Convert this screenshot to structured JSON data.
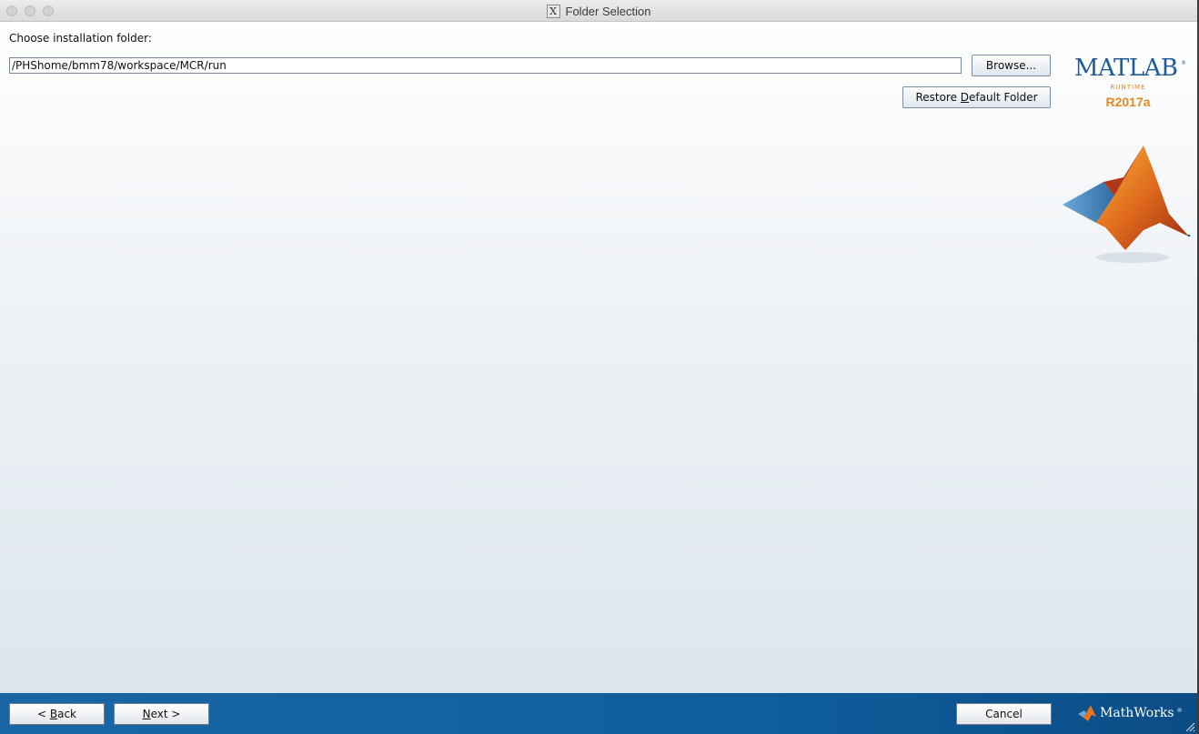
{
  "window": {
    "title": "Folder Selection"
  },
  "main": {
    "choose_label": "Choose installation folder:",
    "folder_path": "/PHShome/bmm78/workspace/MCR/run",
    "browse_label": "Browse...",
    "restore_prefix": "Restore ",
    "restore_mnemonic": "D",
    "restore_suffix": "efault Folder"
  },
  "branding": {
    "product": "MATLAB",
    "reg": "®",
    "subtitle": "RUNTIME",
    "release": "R2017a",
    "company": "MathWorks",
    "company_reg": "®"
  },
  "footer": {
    "back_prefix": "< ",
    "back_mnemonic": "B",
    "back_suffix": "ack",
    "next_mnemonic": "N",
    "next_suffix": "ext >",
    "cancel_label": "Cancel"
  },
  "colors": {
    "footer_blue": "#1966a6",
    "matlab_blue": "#1f5a9a",
    "runtime_orange": "#e08a22"
  }
}
